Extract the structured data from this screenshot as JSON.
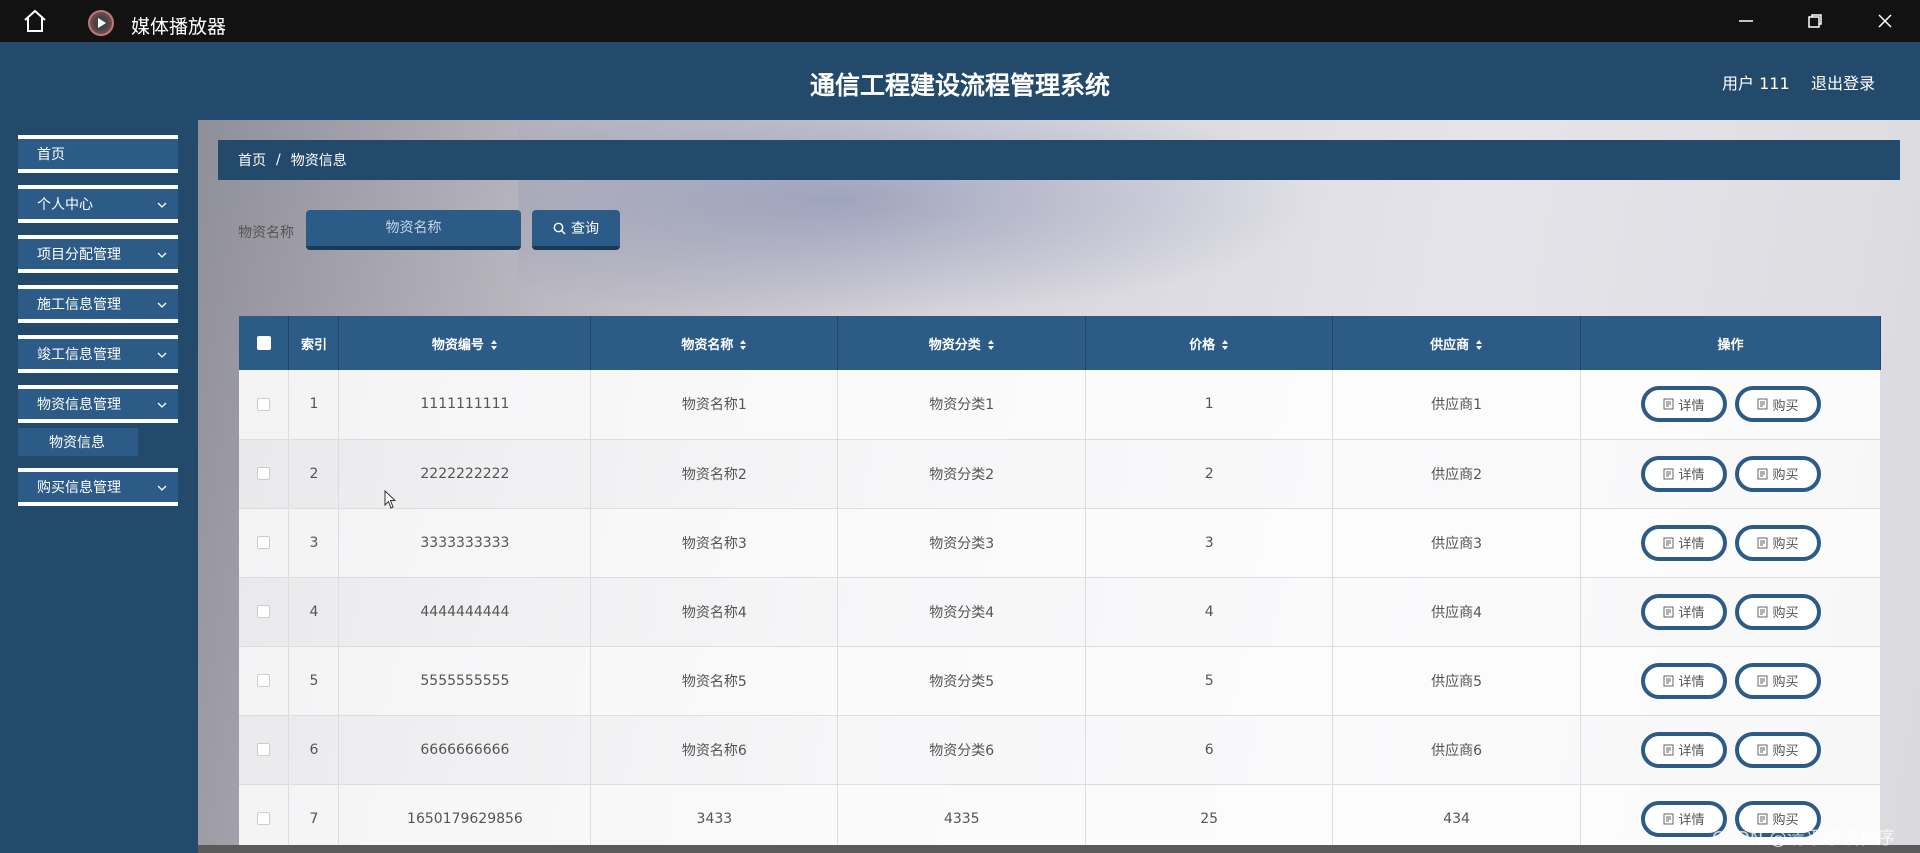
{
  "titlebar": {
    "app_title": "媒体播放器"
  },
  "header": {
    "system_title": "通信工程建设流程管理系统",
    "user": "用户 111",
    "logout": "退出登录"
  },
  "sidebar": {
    "items": [
      {
        "label": "首页"
      },
      {
        "label": "个人中心"
      },
      {
        "label": "项目分配管理"
      },
      {
        "label": "施工信息管理"
      },
      {
        "label": "竣工信息管理"
      },
      {
        "label": "物资信息管理"
      },
      {
        "label": "购买信息管理"
      }
    ],
    "submenu": "物资信息"
  },
  "breadcrumb": {
    "home": "首页",
    "sep": "/",
    "current": "物资信息"
  },
  "search": {
    "label": "物资名称",
    "placeholder": "物资名称",
    "button": "查询"
  },
  "table": {
    "headers": [
      "索引",
      "物资编号",
      "物资名称",
      "物资分类",
      "价格",
      "供应商",
      "操作"
    ],
    "detail_label": "详情",
    "buy_label": "购买",
    "rows": [
      {
        "index": "1",
        "code": "1111111111",
        "name": "物资名称1",
        "category": "物资分类1",
        "price": "1",
        "supplier": "供应商1"
      },
      {
        "index": "2",
        "code": "2222222222",
        "name": "物资名称2",
        "category": "物资分类2",
        "price": "2",
        "supplier": "供应商2"
      },
      {
        "index": "3",
        "code": "3333333333",
        "name": "物资名称3",
        "category": "物资分类3",
        "price": "3",
        "supplier": "供应商3"
      },
      {
        "index": "4",
        "code": "4444444444",
        "name": "物资名称4",
        "category": "物资分类4",
        "price": "4",
        "supplier": "供应商4"
      },
      {
        "index": "5",
        "code": "5555555555",
        "name": "物资名称5",
        "category": "物资分类5",
        "price": "5",
        "supplier": "供应商5"
      },
      {
        "index": "6",
        "code": "6666666666",
        "name": "物资名称6",
        "category": "物资分类6",
        "price": "6",
        "supplier": "供应商6"
      },
      {
        "index": "7",
        "code": "1650179629856",
        "name": "3433",
        "category": "4335",
        "price": "25",
        "supplier": "434"
      }
    ]
  },
  "watermark": "CSDN @清平毕设程序",
  "colors": {
    "primary": "#2b5b86",
    "header": "#234a6b",
    "titlebar": "#121212"
  }
}
